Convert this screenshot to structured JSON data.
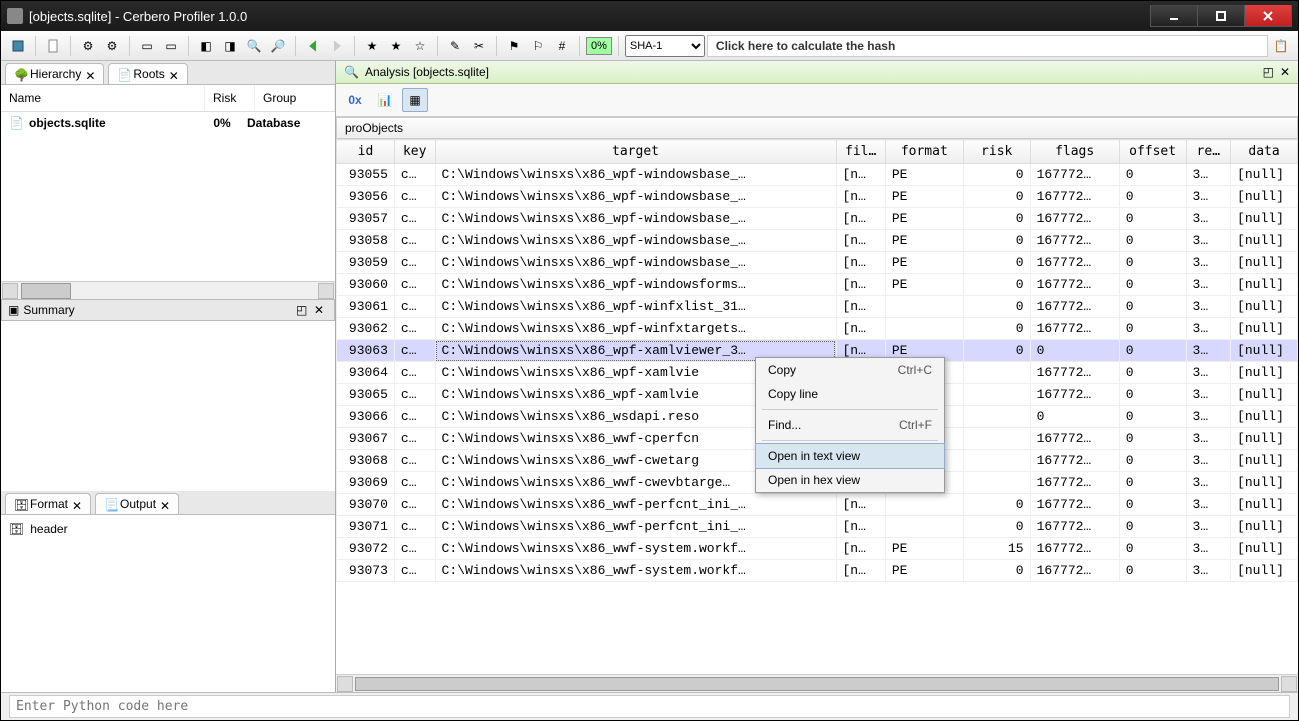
{
  "window": {
    "title": "[objects.sqlite] - Cerbero Profiler 1.0.0"
  },
  "toolbar": {
    "percent": "0%",
    "hash_algo": "SHA-1",
    "hash_hint": "Click here to calculate the hash"
  },
  "left_tabs": {
    "hierarchy": "Hierarchy",
    "roots": "Roots"
  },
  "tree": {
    "cols": {
      "name": "Name",
      "risk": "Risk",
      "group": "Group"
    },
    "row": {
      "name": "objects.sqlite",
      "risk": "0%",
      "group": "Database"
    }
  },
  "summary": {
    "title": "Summary"
  },
  "format_tabs": {
    "format": "Format",
    "output": "Output"
  },
  "format_item": "header",
  "analysis": {
    "title": "Analysis [objects.sqlite]"
  },
  "view_btns": {
    "hex": "0x"
  },
  "grid": {
    "title": "proObjects",
    "cols": [
      "id",
      "key",
      "target",
      "fil…",
      "format",
      "risk",
      "flags",
      "offset",
      "re…",
      "data"
    ],
    "rows": [
      {
        "id": "93055",
        "key": "c…",
        "target": "C:\\Windows\\winsxs\\x86_wpf-windowsbase_…",
        "fil": "[n…",
        "format": "PE",
        "risk": "0",
        "flags": "167772…",
        "offset": "0",
        "re": "3…",
        "data": "[null]"
      },
      {
        "id": "93056",
        "key": "c…",
        "target": "C:\\Windows\\winsxs\\x86_wpf-windowsbase_…",
        "fil": "[n…",
        "format": "PE",
        "risk": "0",
        "flags": "167772…",
        "offset": "0",
        "re": "3…",
        "data": "[null]"
      },
      {
        "id": "93057",
        "key": "c…",
        "target": "C:\\Windows\\winsxs\\x86_wpf-windowsbase_…",
        "fil": "[n…",
        "format": "PE",
        "risk": "0",
        "flags": "167772…",
        "offset": "0",
        "re": "3…",
        "data": "[null]"
      },
      {
        "id": "93058",
        "key": "c…",
        "target": "C:\\Windows\\winsxs\\x86_wpf-windowsbase_…",
        "fil": "[n…",
        "format": "PE",
        "risk": "0",
        "flags": "167772…",
        "offset": "0",
        "re": "3…",
        "data": "[null]"
      },
      {
        "id": "93059",
        "key": "c…",
        "target": "C:\\Windows\\winsxs\\x86_wpf-windowsbase_…",
        "fil": "[n…",
        "format": "PE",
        "risk": "0",
        "flags": "167772…",
        "offset": "0",
        "re": "3…",
        "data": "[null]"
      },
      {
        "id": "93060",
        "key": "c…",
        "target": "C:\\Windows\\winsxs\\x86_wpf-windowsforms…",
        "fil": "[n…",
        "format": "PE",
        "risk": "0",
        "flags": "167772…",
        "offset": "0",
        "re": "3…",
        "data": "[null]"
      },
      {
        "id": "93061",
        "key": "c…",
        "target": "C:\\Windows\\winsxs\\x86_wpf-winfxlist_31…",
        "fil": "[n…",
        "format": "",
        "risk": "0",
        "flags": "167772…",
        "offset": "0",
        "re": "3…",
        "data": "[null]"
      },
      {
        "id": "93062",
        "key": "c…",
        "target": "C:\\Windows\\winsxs\\x86_wpf-winfxtargets…",
        "fil": "[n…",
        "format": "",
        "risk": "0",
        "flags": "167772…",
        "offset": "0",
        "re": "3…",
        "data": "[null]"
      },
      {
        "id": "93063",
        "key": "c…",
        "target": "C:\\Windows\\winsxs\\x86_wpf-xamlviewer_3…",
        "fil": "[n…",
        "format": "PE",
        "risk": "0",
        "flags": "0",
        "offset": "0",
        "re": "3…",
        "data": "[null]",
        "sel": true
      },
      {
        "id": "93064",
        "key": "c…",
        "target": "C:\\Windows\\winsxs\\x86_wpf-xamlvie",
        "fil": "",
        "format": "",
        "risk": "",
        "flags": "167772…",
        "offset": "0",
        "re": "3…",
        "data": "[null]"
      },
      {
        "id": "93065",
        "key": "c…",
        "target": "C:\\Windows\\winsxs\\x86_wpf-xamlvie",
        "fil": "",
        "format": "",
        "risk": "",
        "flags": "167772…",
        "offset": "0",
        "re": "3…",
        "data": "[null]"
      },
      {
        "id": "93066",
        "key": "c…",
        "target": "C:\\Windows\\winsxs\\x86_wsdapi.reso",
        "fil": "",
        "format": "",
        "risk": "",
        "flags": "0",
        "offset": "0",
        "re": "3…",
        "data": "[null]"
      },
      {
        "id": "93067",
        "key": "c…",
        "target": "C:\\Windows\\winsxs\\x86_wwf-cperfcn",
        "fil": "",
        "format": "",
        "risk": "",
        "flags": "167772…",
        "offset": "0",
        "re": "3…",
        "data": "[null]"
      },
      {
        "id": "93068",
        "key": "c…",
        "target": "C:\\Windows\\winsxs\\x86_wwf-cwetarg",
        "fil": "",
        "format": "",
        "risk": "",
        "flags": "167772…",
        "offset": "0",
        "re": "3…",
        "data": "[null]"
      },
      {
        "id": "93069",
        "key": "c…",
        "target": "C:\\Windows\\winsxs\\x86_wwf-cwevbtarge…",
        "fil": "",
        "format": "",
        "risk": "",
        "flags": "167772…",
        "offset": "0",
        "re": "3…",
        "data": "[null]"
      },
      {
        "id": "93070",
        "key": "c…",
        "target": "C:\\Windows\\winsxs\\x86_wwf-perfcnt_ini_…",
        "fil": "[n…",
        "format": "",
        "risk": "0",
        "flags": "167772…",
        "offset": "0",
        "re": "3…",
        "data": "[null]"
      },
      {
        "id": "93071",
        "key": "c…",
        "target": "C:\\Windows\\winsxs\\x86_wwf-perfcnt_ini_…",
        "fil": "[n…",
        "format": "",
        "risk": "0",
        "flags": "167772…",
        "offset": "0",
        "re": "3…",
        "data": "[null]"
      },
      {
        "id": "93072",
        "key": "c…",
        "target": "C:\\Windows\\winsxs\\x86_wwf-system.workf…",
        "fil": "[n…",
        "format": "PE",
        "risk": "15",
        "flags": "167772…",
        "offset": "0",
        "re": "3…",
        "data": "[null]"
      },
      {
        "id": "93073",
        "key": "c…",
        "target": "C:\\Windows\\winsxs\\x86_wwf-system.workf…",
        "fil": "[n…",
        "format": "PE",
        "risk": "0",
        "flags": "167772…",
        "offset": "0",
        "re": "3…",
        "data": "[null]"
      }
    ]
  },
  "ctx": {
    "copy": "Copy",
    "copy_sc": "Ctrl+C",
    "copy_line": "Copy line",
    "find": "Find...",
    "find_sc": "Ctrl+F",
    "open_text": "Open in text view",
    "open_hex": "Open in hex view"
  },
  "footer": {
    "placeholder": "Enter Python code here"
  }
}
